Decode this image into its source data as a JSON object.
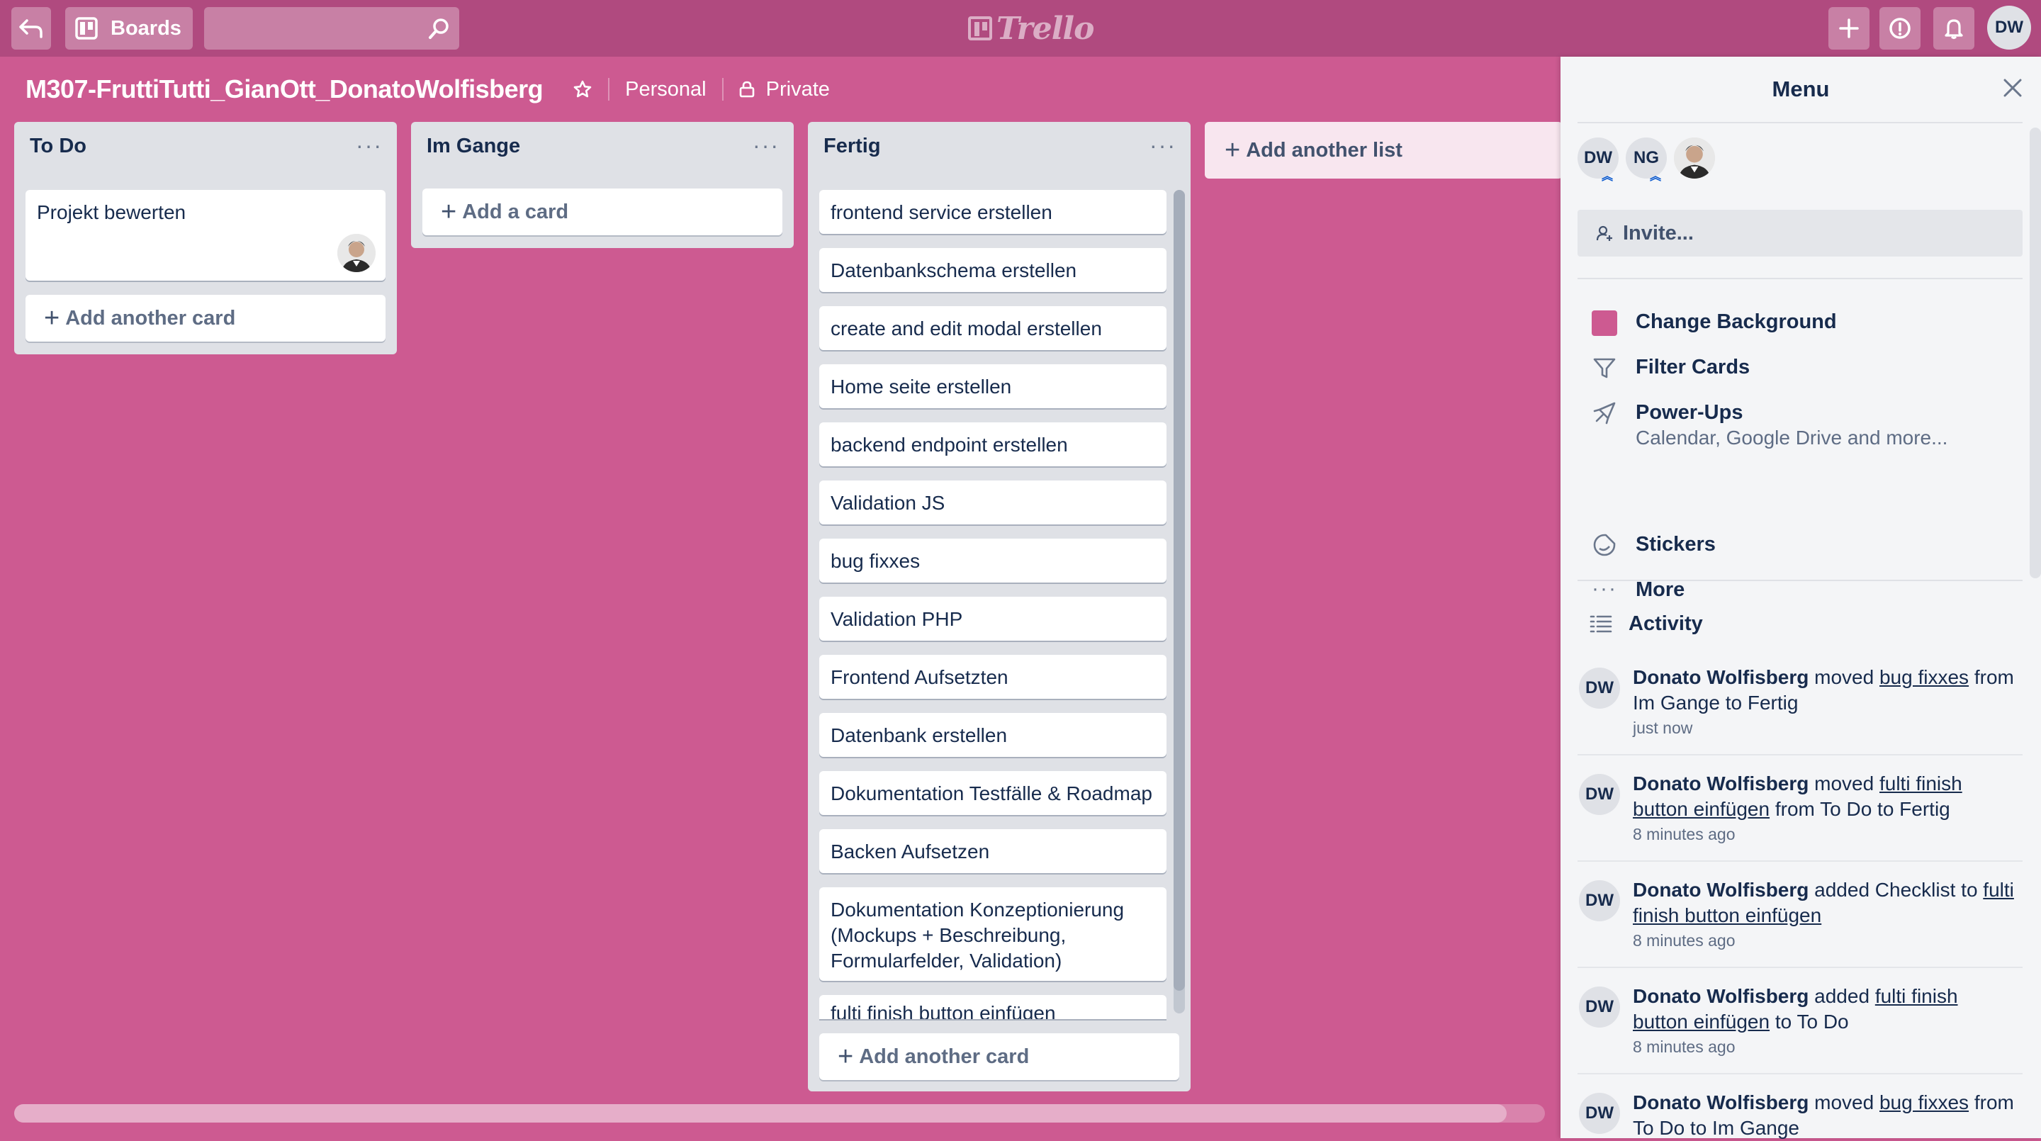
{
  "topbar": {
    "boards_label": "Boards",
    "search_placeholder": "",
    "logo_text": "Trello",
    "user_initials": "DW"
  },
  "board": {
    "title": "M307-FruttiTutti_GianOtt_DonatoWolfisberg",
    "team": "Personal",
    "visibility": "Private",
    "background_color": "#cd5a91"
  },
  "lists": [
    {
      "title": "To Do",
      "cards": [
        "Projekt bewerten"
      ],
      "add_label": "Add another card"
    },
    {
      "title": "Im Gange",
      "cards": [],
      "add_label": "Add a card"
    },
    {
      "title": "Fertig",
      "cards": [
        "frontend service erstellen",
        "Datenbankschema erstellen",
        "create and edit modal erstellen",
        "Home seite erstellen",
        "backend endpoint erstellen",
        "Validation JS",
        "bug fixxes",
        "Validation PHP",
        "Frontend Aufsetzten",
        "Datenbank erstellen",
        "Dokumentation Testfälle & Roadmap",
        "Backen Aufsetzen",
        "Dokumentation Konzeptionierung (Mockups + Beschreibung, Formularfelder, Validation)",
        "fulti finish button einfügen"
      ],
      "add_label": "Add another card"
    }
  ],
  "add_list_label": "Add another list",
  "menu": {
    "title": "Menu",
    "members": [
      "DW",
      "NG"
    ],
    "invite_label": "Invite...",
    "items": {
      "change_background": "Change Background",
      "filter_cards": "Filter Cards",
      "power_ups": "Power-Ups",
      "power_ups_sub": "Calendar, Google Drive and more...",
      "stickers": "Stickers",
      "more": "More"
    },
    "activity_title": "Activity",
    "activity": [
      {
        "initials": "DW",
        "who": "Donato Wolfisberg",
        "action": "moved",
        "link": "bug fixxes",
        "rest": "from Im Gange to Fertig",
        "when": "just now"
      },
      {
        "initials": "DW",
        "who": "Donato Wolfisberg",
        "action": "moved",
        "link": "fulti finish button einfügen",
        "rest": "from To Do to Fertig",
        "when": "8 minutes ago"
      },
      {
        "initials": "DW",
        "who": "Donato Wolfisberg",
        "action": "added Checklist to",
        "link": "fulti finish button einfügen",
        "rest": "",
        "when": "8 minutes ago"
      },
      {
        "initials": "DW",
        "who": "Donato Wolfisberg",
        "action": "added",
        "link": "fulti finish button einfügen",
        "rest": "to To Do",
        "when": "8 minutes ago"
      },
      {
        "initials": "DW",
        "who": "Donato Wolfisberg",
        "action": "moved",
        "link": "bug fixxes",
        "rest": "from To Do to Im Gange",
        "when": ""
      }
    ]
  }
}
